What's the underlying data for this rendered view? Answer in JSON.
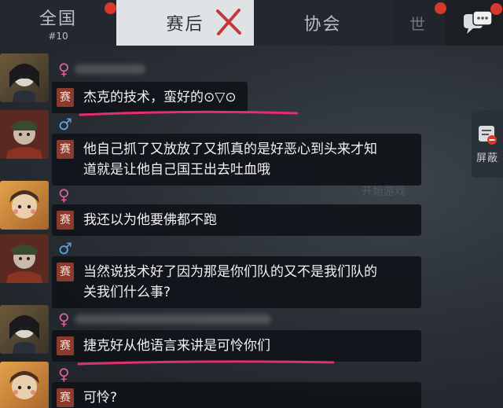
{
  "tabs": [
    {
      "label": "全国",
      "sub": "#10"
    },
    {
      "label": "赛后"
    },
    {
      "label": "协会"
    },
    {
      "label": "世"
    }
  ],
  "side_button": {
    "label": "屏蔽"
  },
  "background_text": {
    "start_game": "开始游戏"
  },
  "messages": [
    {
      "gender": "♀",
      "badge": "赛",
      "text": "杰克的技术，蛮好的⊙▽⊙"
    },
    {
      "gender": "♂",
      "badge": "赛",
      "line1": "他自己抓了又放放了又抓真的是好恶心到头来才知",
      "line2": "道就是让他自己国王出去吐血哦"
    },
    {
      "gender": "♀",
      "badge": "赛",
      "text": "我还以为他要佛都不跑"
    },
    {
      "gender": "♂",
      "badge": "赛",
      "line1": "当然说技术好了因为那是你们队的又不是我们队的",
      "line2": "关我们什么事?"
    },
    {
      "gender": "♀",
      "badge": "赛",
      "text": "捷克好从他语言来讲是可怜你们"
    },
    {
      "gender": "♀",
      "badge": "赛",
      "text": "可怜?"
    }
  ],
  "colors": {
    "accent_underline": "#e0306e",
    "female": "#e0609a",
    "male": "#5aa6e8",
    "badge": "#8b3a2d"
  }
}
